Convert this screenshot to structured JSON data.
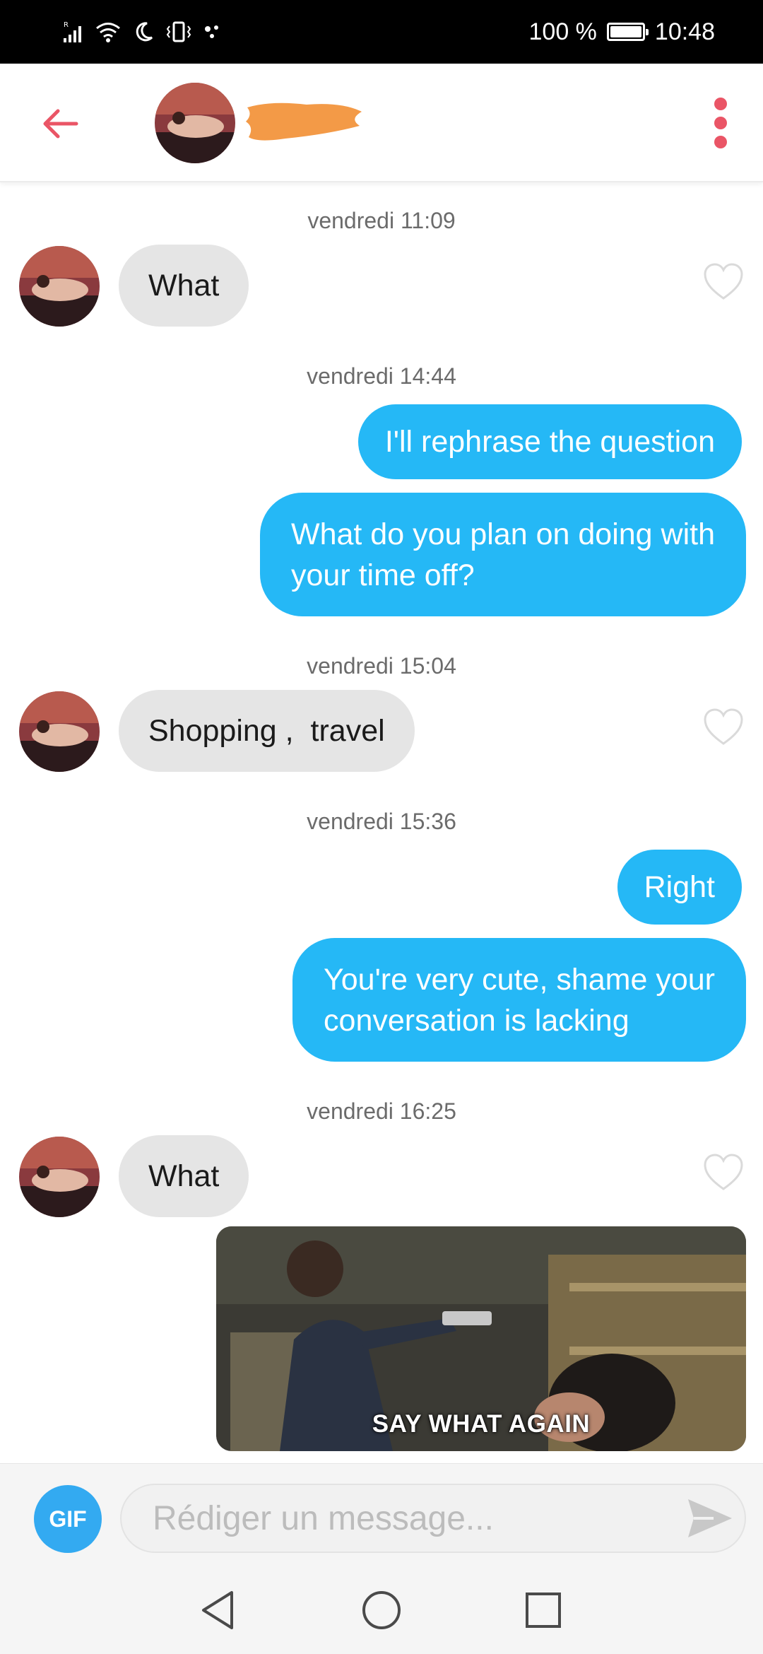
{
  "status_bar": {
    "battery": "100 %",
    "time": "10:48",
    "icons": [
      "signal-icon",
      "wifi-icon",
      "moon-icon",
      "vibrate-icon",
      "dots-icon"
    ]
  },
  "header": {
    "back_icon": "arrow-left-icon",
    "menu_icon": "more-vertical-icon",
    "accent": "#ea5566"
  },
  "messages": [
    {
      "type": "timestamp",
      "text": "vendredi 11:09"
    },
    {
      "type": "incoming",
      "text": "What"
    },
    {
      "type": "timestamp",
      "text": "vendredi 14:44"
    },
    {
      "type": "outgoing",
      "text": "I'll rephrase the question"
    },
    {
      "type": "outgoing",
      "lines": [
        "What do you plan on doing with",
        "your time off?"
      ]
    },
    {
      "type": "timestamp",
      "text": "vendredi 15:04"
    },
    {
      "type": "incoming",
      "text": "Shopping ,  travel"
    },
    {
      "type": "timestamp",
      "text": "vendredi 15:36"
    },
    {
      "type": "outgoing",
      "text": "Right"
    },
    {
      "type": "outgoing",
      "lines": [
        "You're very cute, shame your",
        "conversation is lacking"
      ]
    },
    {
      "type": "timestamp",
      "text": "vendredi 16:25"
    },
    {
      "type": "incoming",
      "text": "What"
    },
    {
      "type": "gif",
      "caption": "SAY WHAT AGAIN"
    }
  ],
  "compose": {
    "gif_label": "GIF",
    "placeholder": "Rédiger un message...",
    "send_icon": "send-icon"
  },
  "nav": [
    "back-triangle-icon",
    "home-circle-icon",
    "recents-square-icon"
  ],
  "colors": {
    "outgoing_bubble": "#25b8f6",
    "incoming_bubble": "#e5e5e5",
    "gif_button": "#33aaf1"
  }
}
